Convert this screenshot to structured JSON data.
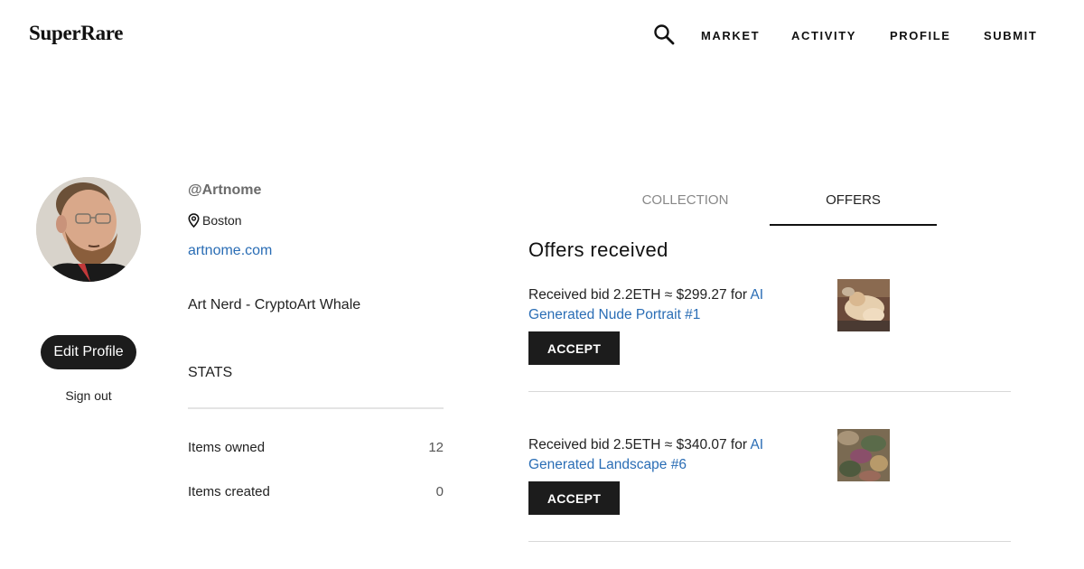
{
  "header": {
    "logo": "SuperRare",
    "nav": {
      "market": "MARKET",
      "activity": "ACTIVITY",
      "profile": "PROFILE",
      "submit": "SUBMIT"
    }
  },
  "profile": {
    "username": "@Artnome",
    "location": "Boston",
    "website": "artnome.com",
    "bio": "Art Nerd - CryptoArt Whale",
    "edit_label": "Edit Profile",
    "signout_label": "Sign out"
  },
  "stats": {
    "heading": "STATS",
    "items": [
      {
        "label": "Items owned",
        "value": "12"
      },
      {
        "label": "Items created",
        "value": "0"
      }
    ]
  },
  "tabs": {
    "collection": "COLLECTION",
    "offers": "OFFERS",
    "active": "offers"
  },
  "offers": {
    "title": "Offers received",
    "items": [
      {
        "prefix": "Received bid 2.2ETH ≈ $299.27 for ",
        "artwork": "AI Generated Nude Portrait #1",
        "button": "ACCEPT"
      },
      {
        "prefix": "Received bid 2.5ETH ≈ $340.07 for ",
        "artwork": "AI Generated Landscape #6",
        "button": "ACCEPT"
      }
    ]
  },
  "colors": {
    "accent_link": "#2a6db5",
    "button_bg": "#1c1c1c",
    "muted_text": "#888888"
  }
}
